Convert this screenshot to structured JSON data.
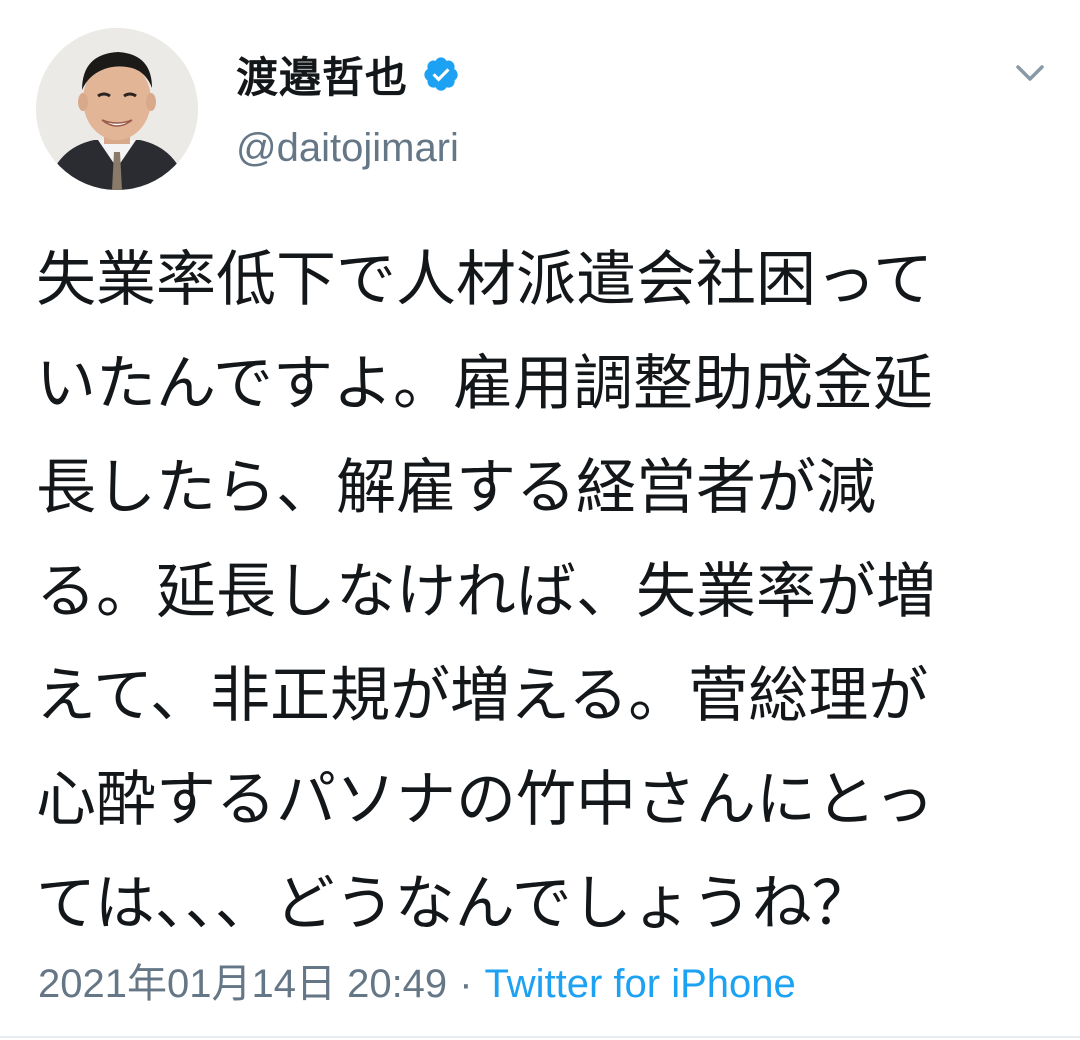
{
  "tweet": {
    "author": {
      "display_name": "渡邉哲也",
      "username": "@daitojimari",
      "verified": true
    },
    "text_lines": [
      "失業率低下で人材派遣会社困って",
      "いたんですよ。雇用調整助成金延",
      "長したら、解雇する経営者が減",
      "る。延長しなければ、失業率が増",
      "えて、非正規が増える。菅総理が",
      "心酔するパソナの竹中さんにとっ",
      "ては、、、どうなんでしょうね？"
    ],
    "datetime": "2021年01月14日 20:49",
    "separator": "·",
    "source": "Twitter for iPhone"
  },
  "icons": {
    "verified": "verified-badge-icon",
    "menu": "chevron-down-icon"
  },
  "colors": {
    "text": "#14171a",
    "secondary": "#657786",
    "accent": "#1da1f2"
  }
}
